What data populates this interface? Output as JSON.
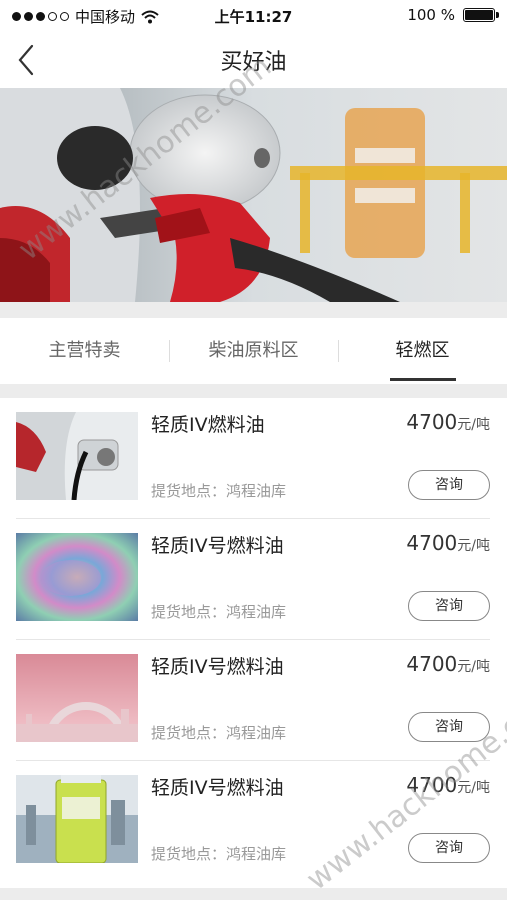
{
  "status_bar": {
    "carrier": "中国移动",
    "time": "上午11:27",
    "battery": "100 %"
  },
  "nav": {
    "title": "买好油"
  },
  "tabs": [
    {
      "label": "主营特卖",
      "active": false
    },
    {
      "label": "柴油原料区",
      "active": false
    },
    {
      "label": "轻燃区",
      "active": true
    }
  ],
  "products": [
    {
      "name": "轻质IV燃料油",
      "price": "4700",
      "unit": "元/吨",
      "location": "提货地点：鸿程油库",
      "action": "咨询",
      "thumb_icon": "car-charging-photo"
    },
    {
      "name": "轻质IV号燃料油",
      "price": "4700",
      "unit": "元/吨",
      "location": "提货地点：鸿程油库",
      "action": "咨询",
      "thumb_icon": "oil-sheen-photo"
    },
    {
      "name": "轻质IV号燃料油",
      "price": "4700",
      "unit": "元/吨",
      "location": "提货地点：鸿程油库",
      "action": "咨询",
      "thumb_icon": "industrial-skyline-photo"
    },
    {
      "name": "轻质IV号燃料油",
      "price": "4700",
      "unit": "元/吨",
      "location": "提货地点：鸿程油库",
      "action": "咨询",
      "thumb_icon": "oil-bottle-photo"
    }
  ],
  "watermark": "www.hackhome.com"
}
